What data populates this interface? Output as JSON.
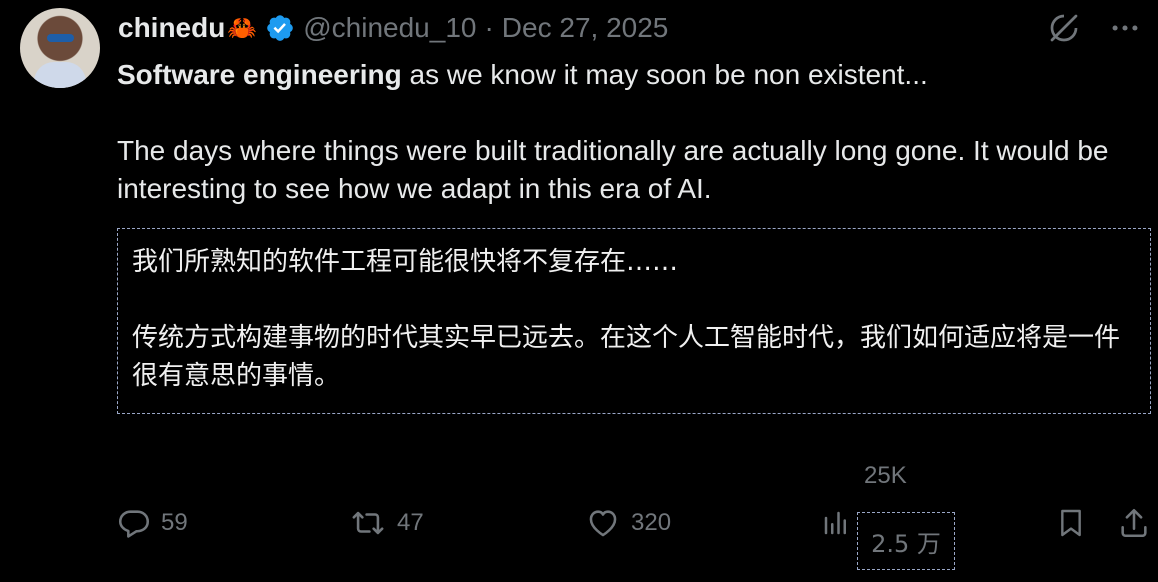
{
  "author": {
    "display_name": "chinedu",
    "name_emoji": "🦀",
    "handle": "@chinedu_10",
    "separator": "·",
    "date": "Dec 27, 2025",
    "verified": true
  },
  "post": {
    "line1_bold": "Software engineering",
    "line1_rest": " as we know it may soon be non existent...",
    "paragraph2": "The days where things were built traditionally are actually long gone. It would be interesting to see how we adapt in this era of AI."
  },
  "translation": {
    "paragraph1": "我们所熟知的软件工程可能很快将不复存在……",
    "paragraph2": "传统方式构建事物的时代其实早已远去。在这个人工智能时代，我们如何适应将是一件很有意思的事情。"
  },
  "metrics": {
    "replies": "59",
    "reposts": "47",
    "likes": "320",
    "views": "25K",
    "views_translated": "2.5 万"
  },
  "icons": {
    "top": [
      "grok-icon",
      "more-icon"
    ],
    "actions": [
      "reply-icon",
      "repost-icon",
      "like-icon",
      "views-icon",
      "bookmark-icon",
      "share-icon"
    ]
  },
  "colors": {
    "background": "#000000",
    "text": "#e7e9ea",
    "muted": "#71767b",
    "verified": "#1d9bf0"
  }
}
